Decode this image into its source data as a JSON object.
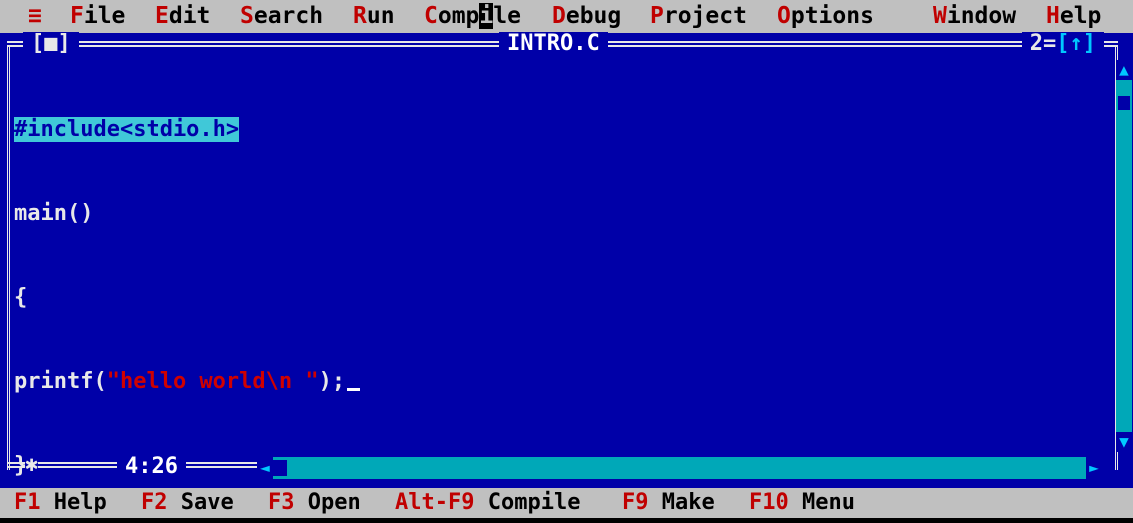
{
  "menu": {
    "system_glyph": "≡",
    "items": [
      {
        "hotkey": "F",
        "rest": "ile"
      },
      {
        "hotkey": "E",
        "rest": "dit"
      },
      {
        "hotkey": "S",
        "rest": "earch"
      },
      {
        "hotkey": "R",
        "rest": "un"
      },
      {
        "hotkey": "C",
        "rest": "ompile"
      },
      {
        "hotkey": "D",
        "rest": "ebug"
      },
      {
        "hotkey": "P",
        "rest": "roject"
      },
      {
        "hotkey": "O",
        "rest": "ptions"
      },
      {
        "hotkey": "W",
        "rest": "indow"
      },
      {
        "hotkey": "H",
        "rest": "elp"
      }
    ]
  },
  "window": {
    "close_box": "[■]",
    "title": "INTRO.C",
    "number": "2",
    "zoom_box": "[↑]",
    "cursor_position": "4:26"
  },
  "editor": {
    "lines": [
      {
        "text": "#include<stdio.h>"
      },
      {
        "text": "main()"
      },
      {
        "text": "{"
      },
      {
        "pre": "printf(",
        "string": "\"hello world\\n \"",
        "post": ");"
      },
      {
        "text": "}"
      }
    ]
  },
  "scrollbar": {
    "up_arrow": "▲",
    "down_arrow": "▼",
    "left_arrow": "◄",
    "right_arrow": "►"
  },
  "statusbar": {
    "items": [
      {
        "key": "F1",
        "label": "Help"
      },
      {
        "key": "F2",
        "label": "Save"
      },
      {
        "key": "F3",
        "label": "Open"
      },
      {
        "key": "Alt-F9",
        "label": "Compile"
      },
      {
        "key": "F9",
        "label": "Make"
      },
      {
        "key": "F10",
        "label": "Menu"
      }
    ]
  },
  "colors": {
    "background": "#0000a8",
    "menu_bg": "#c0c0c0",
    "hotkey": "#c00000",
    "highlight": "#40c8d8",
    "string": "#d00000"
  }
}
